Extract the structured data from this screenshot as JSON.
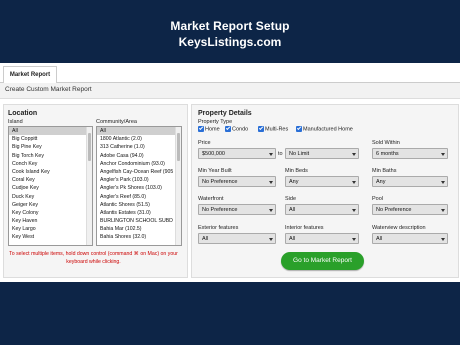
{
  "header": {
    "title": "Market Report Setup",
    "site": "KeysListings.com"
  },
  "tabs": [
    {
      "label": "Market Report"
    }
  ],
  "subheading": "Create Custom Market Report",
  "location": {
    "title": "Location",
    "island_label": "Island",
    "islands": [
      "All",
      "Big Coppitt",
      "Big Pine Key",
      "Big Torch Key",
      "Conch Key",
      "Cook Island Key",
      "Coral Key",
      "Cudjoe Key",
      "Duck Key",
      "Geiger Key",
      "Key Colony",
      "Key Haven",
      "Key Largo",
      "Key West"
    ],
    "community_label": "Community/Area",
    "communities": [
      "All",
      "1800 Atlantic (2.0)",
      "313 Catherine (1.0)",
      "Adobe Casa (94.0)",
      "Anchor Condominium (93.0)",
      "Angelfish Cay-Ocean Reef (905",
      "Angler's Park (103.0)",
      "Angler's Pk Shores (103.0)",
      "Angler's Reef (85.0)",
      "Atlantic Shores (51.5)",
      "Atlantis Estates (31.0)",
      "BURLINGTON SCHOOL SUBD",
      "Bahia Mar (102.5)",
      "Bahia Shores (32.0)"
    ],
    "note": "To select multiple items, hold down control (command ⌘ on Mac) on your keyboard while clicking."
  },
  "property": {
    "title": "Property Details",
    "type_label": "Property Type",
    "types": [
      "Home",
      "Condo",
      "Multi-Res",
      "Manufactured Home"
    ],
    "price_label": "Price",
    "price_from": "$500,000",
    "price_to_word": "to",
    "price_to": "No Limit",
    "sold_within_label": "Sold Within",
    "sold_within": "6 months",
    "min_year_label": "Min Year Built",
    "min_year": "No Preference",
    "min_beds_label": "Min Beds",
    "min_beds": "Any",
    "min_baths_label": "Min Baths",
    "min_baths": "Any",
    "waterfront_label": "Waterfront",
    "waterfront": "No Preference",
    "side_label": "Side",
    "side": "All",
    "pool_label": "Pool",
    "pool": "No Preference",
    "exterior_label": "Exterior features",
    "exterior": "All",
    "interior_label": "Interior features",
    "interior": "All",
    "waterview_label": "Waterview description",
    "waterview": "All"
  },
  "go_button": "Go to Market Report",
  "colors": {
    "background": "#0d2547",
    "button": "#2aa02a",
    "checkbox": "#2a6fd6",
    "note": "#cc0000"
  }
}
